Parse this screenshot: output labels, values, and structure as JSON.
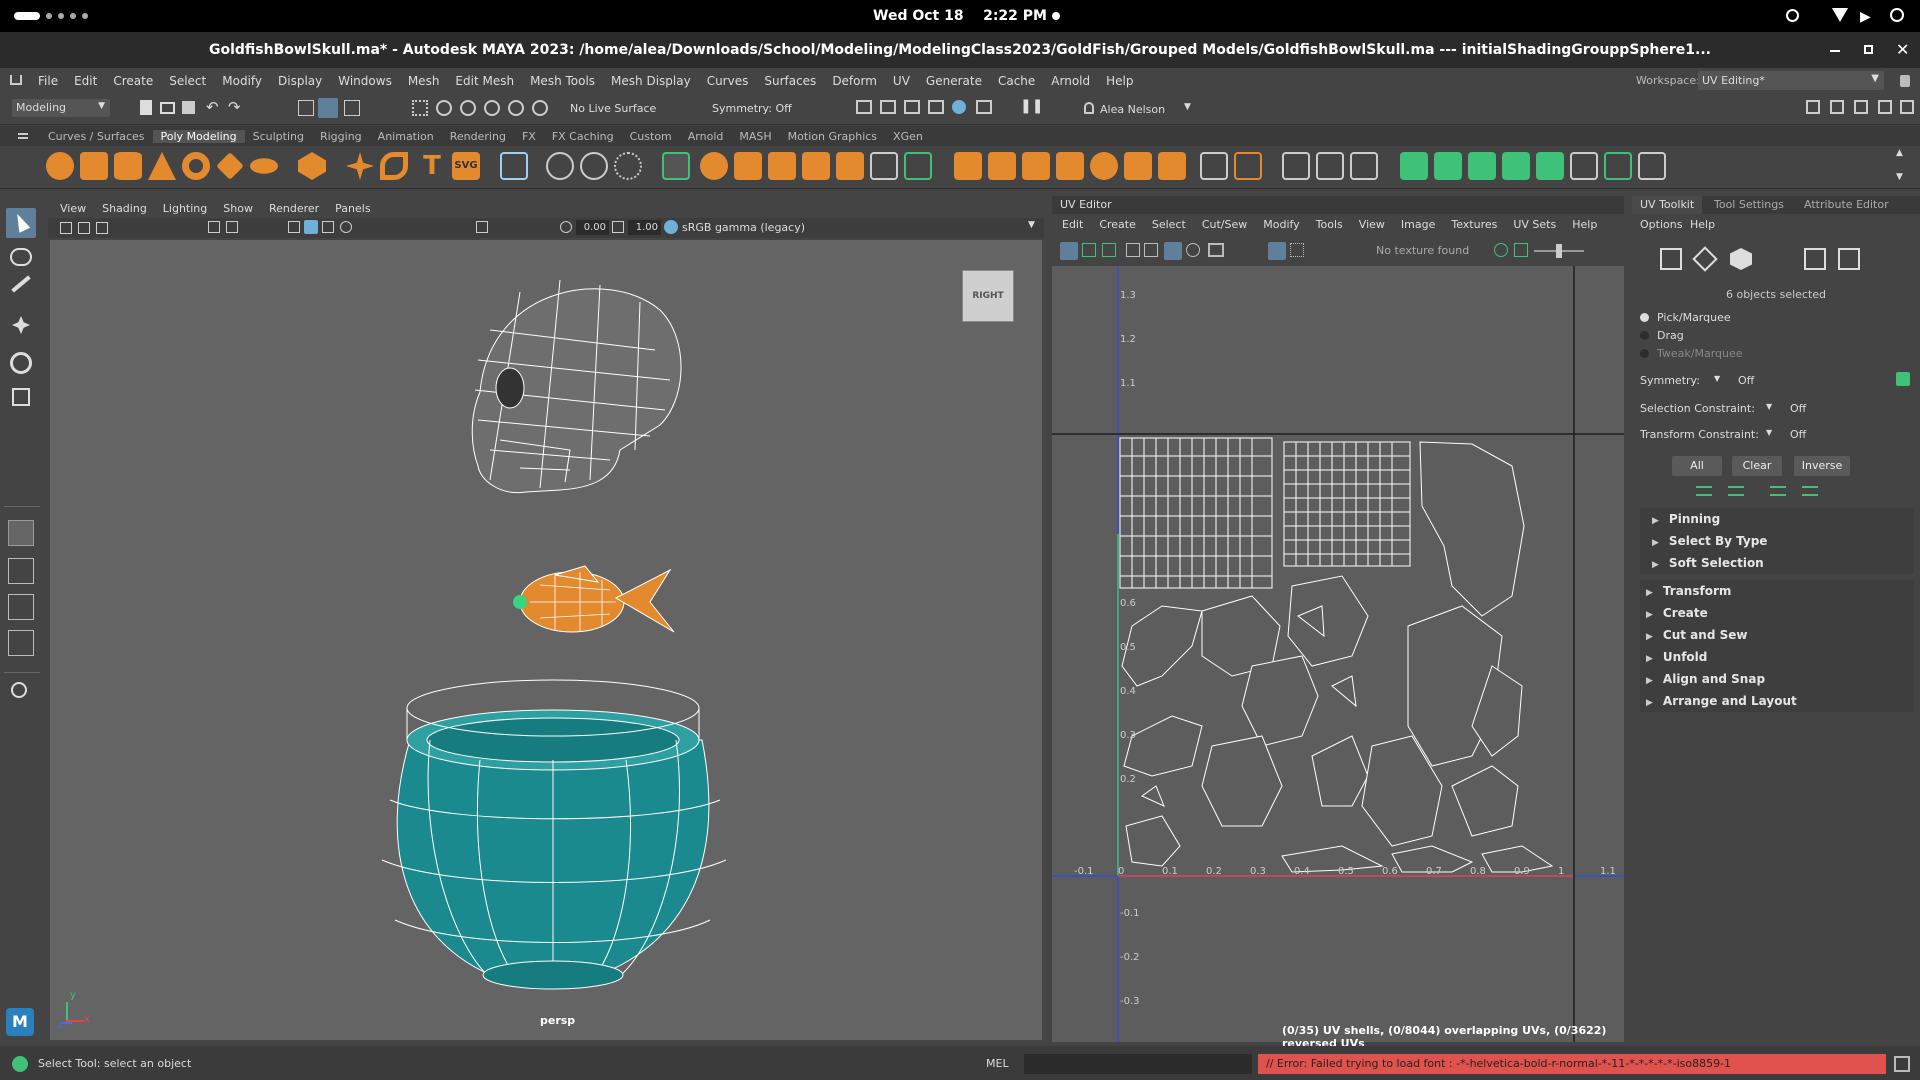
{
  "topbar": {
    "date": "Wed Oct 18",
    "time": "2:22 PM"
  },
  "window": {
    "title": "GoldfishBowlSkull.ma* - Autodesk MAYA 2023: /home/alea/Downloads/School/Modeling/ModelingClass2023/GoldFish/Grouped Models/GoldfishBowlSkull.ma  ---  initialShadingGrouppSphere1..."
  },
  "menubar": {
    "items": [
      "File",
      "Edit",
      "Create",
      "Select",
      "Modify",
      "Display",
      "Windows",
      "Mesh",
      "Edit Mesh",
      "Mesh Tools",
      "Mesh Display",
      "Curves",
      "Surfaces",
      "Deform",
      "UV",
      "Generate",
      "Cache",
      "Arnold",
      "Help"
    ],
    "workspace_label": "Workspace:",
    "workspace_value": "UV Editing*"
  },
  "statusline": {
    "mode": "Modeling",
    "live_surface": "No Live Surface",
    "symmetry": "Symmetry: Off",
    "user": "Alea Nelson"
  },
  "shelf_tabs": [
    "Curves / Surfaces",
    "Poly Modeling",
    "Sculpting",
    "Rigging",
    "Animation",
    "Rendering",
    "FX",
    "FX Caching",
    "Custom",
    "Arnold",
    "MASH",
    "Motion Graphics",
    "XGen"
  ],
  "viewport": {
    "menu": [
      "View",
      "Shading",
      "Lighting",
      "Show",
      "Renderer",
      "Panels"
    ],
    "field_a": "0.00",
    "field_b": "1.00",
    "colorspace": "sRGB gamma (legacy)",
    "viewcube": "RIGHT",
    "camera": "persp",
    "axis_y": "y",
    "axis_z": "z",
    "axis_x": "x"
  },
  "uv_editor": {
    "title": "UV Editor",
    "menu": [
      "Edit",
      "Create",
      "Select",
      "Cut/Sew",
      "Modify",
      "Tools",
      "View",
      "Image",
      "Textures",
      "UV Sets",
      "Help"
    ],
    "no_texture": "No texture found",
    "x_ticks": [
      "-0.1",
      "0",
      "0.1",
      "0.2",
      "0.3",
      "0.4",
      "0.5",
      "0.6",
      "0.7",
      "0.8",
      "0.9",
      "1",
      "1.1"
    ],
    "y_ticks": [
      "1.3",
      "1.2",
      "1.1",
      "0.6",
      "0.5",
      "0.4",
      "0.3",
      "0.2",
      "-0.1",
      "-0.2",
      "-0.3"
    ],
    "stats": "(0/35) UV shells, (0/8044) overlapping UVs, (0/3622) reversed UVs"
  },
  "toolkit": {
    "tabs": [
      "UV Toolkit",
      "Tool Settings",
      "Attribute Editor"
    ],
    "menu": [
      "Options",
      "Help"
    ],
    "selected": "6 objects selected",
    "modes": [
      "Pick/Marquee",
      "Drag",
      "Tweak/Marquee"
    ],
    "symmetry_label": "Symmetry:",
    "symmetry_value": "Off",
    "sel_constraint_label": "Selection Constraint:",
    "sel_constraint_value": "Off",
    "xf_constraint_label": "Transform Constraint:",
    "xf_constraint_value": "Off",
    "buttons": [
      "All",
      "Clear",
      "Inverse"
    ],
    "sub_sections": [
      "Pinning",
      "Select By Type",
      "Soft Selection"
    ],
    "sections": [
      "Transform",
      "Create",
      "Cut and Sew",
      "Unfold",
      "Align and Snap",
      "Arrange and Layout"
    ]
  },
  "helpline": {
    "message": "Select Tool: select an object",
    "mel": "MEL",
    "error": "// Error: Failed trying to load font : -*-helvetica-bold-r-normal-*-11-*-*-*-*-*-iso8859-1"
  },
  "colors": {
    "accent_orange": "#e38a2e",
    "uv_teal": "#2fbfa0",
    "bowl": "#1a8a8e",
    "error_bg": "#e0524e"
  }
}
